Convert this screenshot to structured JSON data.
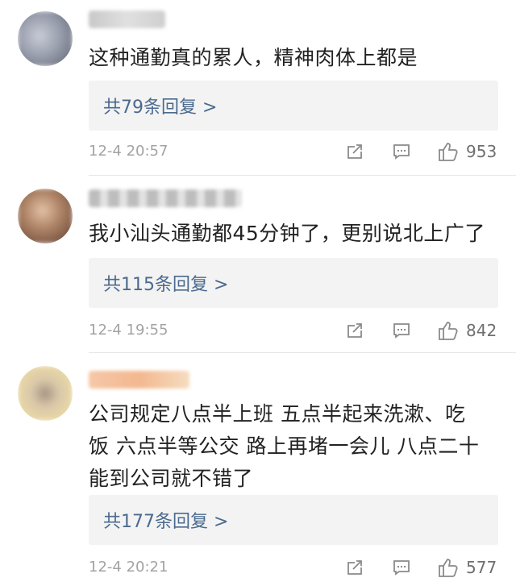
{
  "comments": [
    {
      "text": "这种通勤真的累人，精神肉体上都是",
      "replies": "共79条回复 >",
      "time": "12-4 20:57",
      "likes": "953",
      "avatar_colors": [
        "#9a9fae",
        "#b4b8c6",
        "#7f8391"
      ],
      "name_colors": [
        "#c8c8c8",
        "#dadada"
      ]
    },
    {
      "text": "我小汕头通勤都45分钟了，更别说北上广了",
      "replies": "共115条回复 >",
      "time": "12-4 19:55",
      "likes": "842",
      "avatar_colors": [
        "#d8b49b",
        "#7c5a47",
        "#c89b7d"
      ],
      "name_colors": [
        "#b9b9b9",
        "#e0e0e0"
      ]
    },
    {
      "text_lines": [
        "公司规定八点半上班 五点半起来洗漱、吃",
        "饭 六点半等公交 路上再堵一会儿 八点二十",
        "能到公司就不错了"
      ],
      "replies": "共177条回复 >",
      "time": "12-4 20:21",
      "likes": "577",
      "avatar_colors": [
        "#f1df9c",
        "#c9b5a1",
        "#8c7a6e"
      ],
      "name_colors": [
        "#f3c4a7",
        "#f6dfc0"
      ]
    }
  ],
  "icons": {
    "share": "share-icon",
    "comment": "comment-icon",
    "like": "thumbs-up-icon"
  }
}
